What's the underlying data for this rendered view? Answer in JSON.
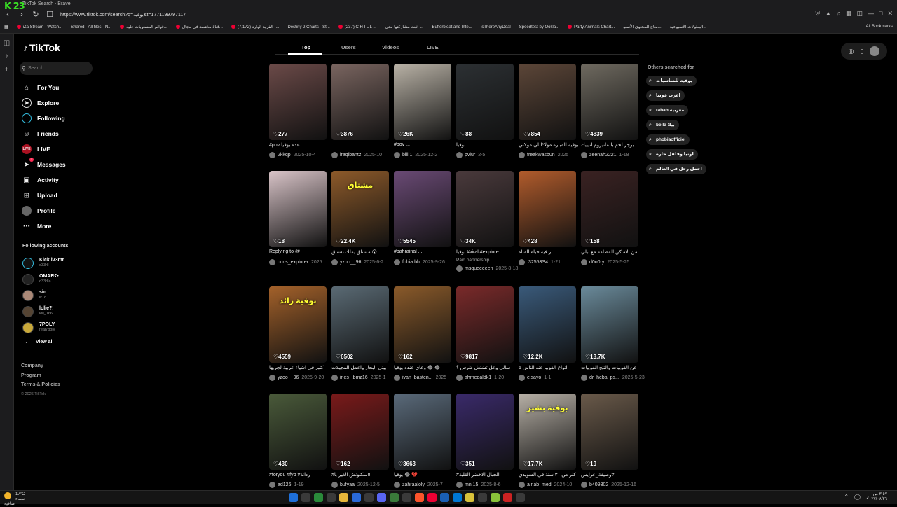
{
  "browser": {
    "tab_title": "TikTok Search - Brave",
    "url": "https://www.tiktok.com/search?q=بوفيه&t=1771199797117",
    "logo_text": "K 23"
  },
  "bookmarks": [
    "iZa Stream - Watch...",
    "Shared - All files - N...",
    "قوائم المستويات عليه...",
    "قناة مختصة في مجال...",
    "(7,172) الفريد الوارد -...",
    "Destiny 2 Charts - St...",
    "(237) C H I L L ...",
    "ثبت مشاركتها معي -...",
    "Bufferbloat and Inte...",
    "IsThereAnyDeal",
    "Speedtest by Ookla...",
    "Party Animals Chart...",
    "متاح المحتوى الأسبو...",
    "البطولات الأسبوعية..."
  ],
  "bookmarks_all": "All Bookmarks",
  "sidebar": {
    "brand": "TikTok",
    "search_placeholder": "Search",
    "nav": [
      {
        "label": "For You",
        "icon": "home-icon"
      },
      {
        "label": "Explore",
        "icon": "compass-icon"
      },
      {
        "label": "Following",
        "icon": "following-icon"
      },
      {
        "label": "Friends",
        "icon": "friends-icon"
      },
      {
        "label": "LIVE",
        "icon": "live-icon"
      },
      {
        "label": "Messages",
        "icon": "messages-icon"
      },
      {
        "label": "Activity",
        "icon": "activity-icon"
      },
      {
        "label": "Upload",
        "icon": "upload-icon"
      },
      {
        "label": "Profile",
        "icon": "profile-icon"
      },
      {
        "label": "More",
        "icon": "more-icon"
      }
    ],
    "messages_badge": "2",
    "following_title": "Following accounts",
    "accounts": [
      {
        "name": "Kick iv3mr",
        "handle": "o33rll"
      },
      {
        "name": "OMARʕ•",
        "handle": "o33rlla"
      },
      {
        "name": "sin",
        "handle": "lk1o"
      },
      {
        "name": "lolie?!",
        "handle": "loll_166"
      },
      {
        "name": "7POLY",
        "handle": "real7poly"
      }
    ],
    "view_all": "View all",
    "footer": [
      "Company",
      "Program",
      "Terms & Policies"
    ],
    "copyright": "© 2026 TikTok"
  },
  "tabs": [
    "Top",
    "Users",
    "Videos",
    "LIVE"
  ],
  "others_title": "Others searched for",
  "suggestions": [
    "بوفيه للمناسبات",
    "اغرب فوبيا",
    "rabab مغربية",
    "bella بيلا",
    "phobiaofficiel",
    "لونيا وفلفل حارة",
    "اجمل رحل في العالم"
  ],
  "videos": [
    {
      "likes": "277",
      "caption": "#pov عدة بوفيا",
      "user": "2kkqp",
      "date": "2025-10-4",
      "color": "#6b4a48"
    },
    {
      "likes": "3876",
      "caption": "",
      "user": "iraqibantz",
      "date": "2025-10",
      "color": "#7a6560"
    },
    {
      "likes": "26K",
      "caption": "#pov ...",
      "user": "bili:1",
      "date": "2025-12-2",
      "color": "#b9b2a6"
    },
    {
      "likes": "88",
      "caption": "بوفيا",
      "user": "pvlur",
      "date": "2-5",
      "color": "#2c3033"
    },
    {
      "likes": "7854",
      "caption": "بوفية المبارة مولا*اللي مولاتي",
      "user": "freakwasb0n",
      "date": "2025",
      "color": "#5c4638"
    },
    {
      "likes": "4839",
      "caption": "برجر لحم بالماتيروم لتيييك",
      "user": "zeenah2221",
      "date": "1-18",
      "color": "#6f6a60"
    },
    {
      "likes": "18",
      "caption": "Replying to @",
      "user": "curls_explorer",
      "date": "2025",
      "color": "#d9c4c8"
    },
    {
      "likes": "22.4K",
      "caption": "مشتاق يملك تشتاق 😮",
      "user": "yzoo__96",
      "date": "2025-6-2",
      "color": "#8d5a2a",
      "overlay": "مشتاق"
    },
    {
      "likes": "5545",
      "caption": "#bahrainal ...",
      "user": "fobia.bh",
      "date": "2025-9-26",
      "color": "#6a4a75"
    },
    {
      "likes": "34K",
      "caption": "بوفيا #viral #explore ...",
      "user": "msqueeeeen",
      "date": "2025-8-18",
      "color": "#4a3a3c",
      "paid": "Paid partnership"
    },
    {
      "likes": "428",
      "caption": "بر فيه حياة القناة",
      "user": ".32553S4",
      "date": "1-21",
      "color": "#b25c2c"
    },
    {
      "likes": "158",
      "caption": "من الاماكن المطلقة مع بيلي",
      "user": "d0o0ry",
      "date": "2025-5-25",
      "color": "#3a2222"
    },
    {
      "likes": "4559",
      "caption": "اكتبر في اشياء عربية لجربها",
      "user": "yzoo__96",
      "date": "2025-9-20",
      "color": "#a3612a",
      "overlay": "بوفية رائد"
    },
    {
      "likes": "6502",
      "caption": "بيتي البحار واعمل المجيلات",
      "user": "ines_.bmz16",
      "date": "2025-1",
      "color": "#5a6a74"
    },
    {
      "likes": "162",
      "caption": "وعاي عنده بوفيا 😂 😂",
      "user": "ivan_basten...",
      "date": "2025",
      "color": "#8a5a2a"
    },
    {
      "likes": "9817",
      "caption": "سالي وعل تشتغل ظرس ؟",
      "user": "ahmedaldk1",
      "date": "1-20",
      "color": "#7a2a2a"
    },
    {
      "likes": "12.2K",
      "caption": "5 انواع الفوبيا عند الناس",
      "user": "eisayo",
      "date": "1-1",
      "color": "#3a5a7a"
    },
    {
      "likes": "13.7K",
      "caption": "عن الفوبيات والنتج الفوبيات",
      "user": "dr_heba_ps...",
      "date": "2025-5-23",
      "color": "#6a8a9a"
    },
    {
      "likes": "430",
      "caption": "#foryou #fyp #ردانة",
      "user": "ad126",
      "date": "1-19",
      "color": "#4a5a3a"
    },
    {
      "likes": "162",
      "caption": "#سكتونش الغير با!!!",
      "user": "bufyaa",
      "date": "2025-12-5",
      "color": "#7a1a1a"
    },
    {
      "likes": "3663",
      "caption": "بوفيا 😂 💔",
      "user": "zahraaloly",
      "date": "2025-7",
      "color": "#5a6a7a"
    },
    {
      "likes": "351",
      "caption": "#الجبال الاخضر القلبة",
      "user": "mn.15",
      "date": "2025-8-6",
      "color": "#3a2a6a"
    },
    {
      "likes": "17.7K",
      "caption": "كلر من ٣٠ سنة في السويدي",
      "user": "ainab_med",
      "date": "2024-10",
      "color": "#b7b0a6",
      "overlay": "بوفية بشير"
    },
    {
      "likes": "19",
      "caption": "وصيفة_عرايس#",
      "user": "b409302",
      "date": "2025-12-16",
      "color": "#6a5a4a"
    }
  ],
  "taskbar": {
    "temp": "17°C",
    "weather": "سماء صافية",
    "time": "٣:٥٧ ص",
    "date": "٢٧/٠٨/٢٦"
  }
}
